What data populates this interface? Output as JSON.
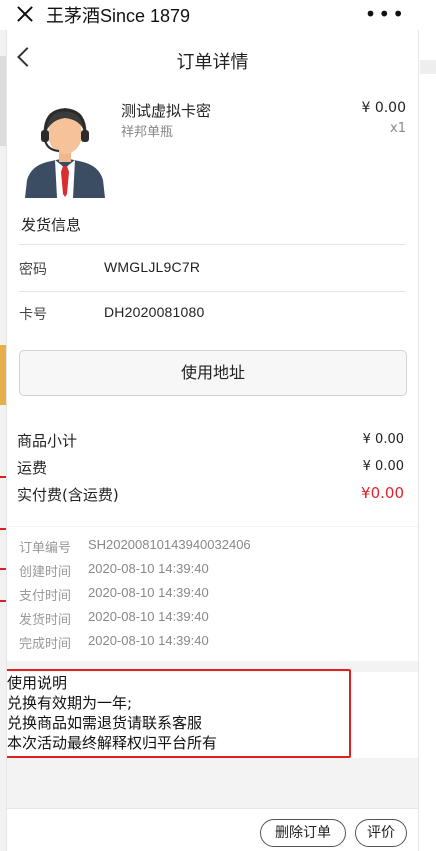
{
  "topbar": {
    "title": "王茅酒Since 1879",
    "more": "•••"
  },
  "header": {
    "title": "订单详情"
  },
  "product": {
    "name": "测试虚拟卡密",
    "subtitle": "祥邦单瓶",
    "price": "¥ 0.00",
    "quantity": "x1"
  },
  "shipping": {
    "title": "发货信息",
    "password_label": "密码",
    "password_value": "WMGLJL9C7R",
    "card_label": "卡号",
    "card_value": "DH2020081080",
    "use_address_button": "使用地址"
  },
  "fees": {
    "subtotal_label": "商品小计",
    "subtotal_value": "¥ 0.00",
    "shipping_label": "运费",
    "shipping_value": "¥ 0.00",
    "paid_label": "实付费(含运费)",
    "paid_value": "¥0.00"
  },
  "meta": {
    "order_no_label": "订单编号",
    "order_no": "SH20200810143940032406",
    "created_label": "创建时间",
    "created": "2020-08-10 14:39:40",
    "paid_label": "支付时间",
    "paid": "2020-08-10 14:39:40",
    "shipped_label": "发货时间",
    "shipped": "2020-08-10 14:39:40",
    "completed_label": "完成时间",
    "completed": "2020-08-10 14:39:40"
  },
  "notes": {
    "title": "使用说明",
    "line1": "兑换有效期为一年;",
    "line2": "兑换商品如需退货请联系客服",
    "line3": "本次活动最终解释权归平台所有"
  },
  "actions": {
    "delete_label": "删除订单",
    "review_label": "评价"
  },
  "colors": {
    "accent_red": "#e0242b",
    "annotation_red": "#e02020"
  },
  "icons": {
    "close": "close-icon",
    "more": "more-icon",
    "back": "chevron-left-icon",
    "avatar": "customer-service-avatar-icon"
  }
}
